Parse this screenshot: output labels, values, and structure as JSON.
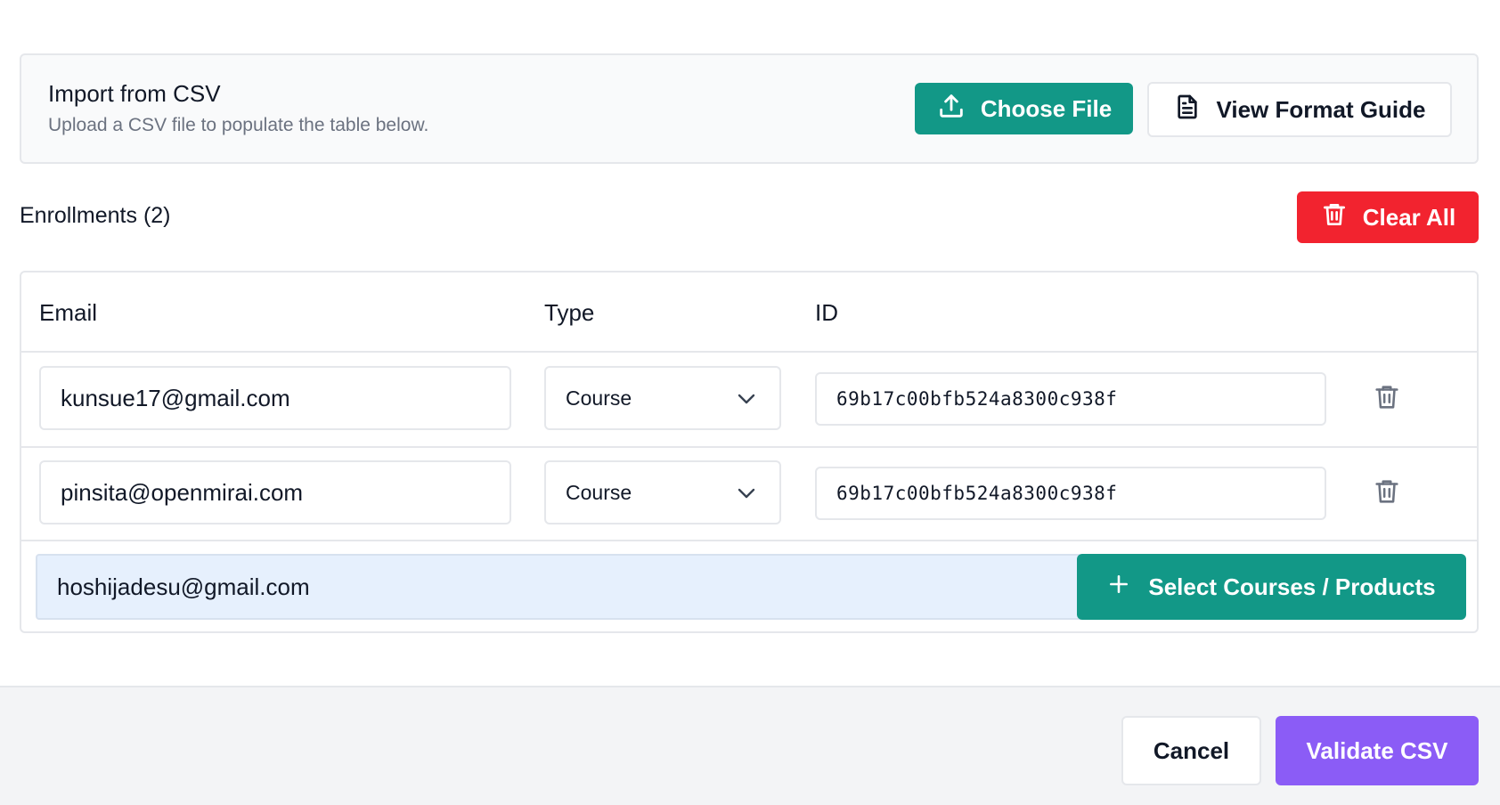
{
  "import": {
    "title": "Import from CSV",
    "subtitle": "Upload a CSV file to populate the table below.",
    "choose_label": "Choose File",
    "guide_label": "View Format Guide"
  },
  "enrollments": {
    "title": "Enrollments (2)",
    "clear_label": "Clear All",
    "columns": [
      "Email",
      "Type",
      "ID"
    ],
    "rows": [
      {
        "email": "kunsue17@gmail.com",
        "type": "Course",
        "id": "69b17c00bfb524a8300c938f"
      },
      {
        "email": "pinsita@openmirai.com",
        "type": "Course",
        "id": "69b17c00bfb524a8300c938f"
      }
    ],
    "new_email": "hoshijadesu@gmail.com",
    "select_label": "Select Courses / Products"
  },
  "footer": {
    "cancel_label": "Cancel",
    "validate_label": "Validate CSV"
  },
  "colors": {
    "teal": "#129887",
    "red": "#f2232f",
    "purple": "#8b5cf6",
    "highlight": "#e6f0fd"
  },
  "icons": {
    "choose": "upload-icon",
    "guide": "document-icon",
    "clear": "trash-icon",
    "row_delete": "trash-icon",
    "type_select": "chevron-down-icon",
    "select_courses": "plus-icon"
  }
}
